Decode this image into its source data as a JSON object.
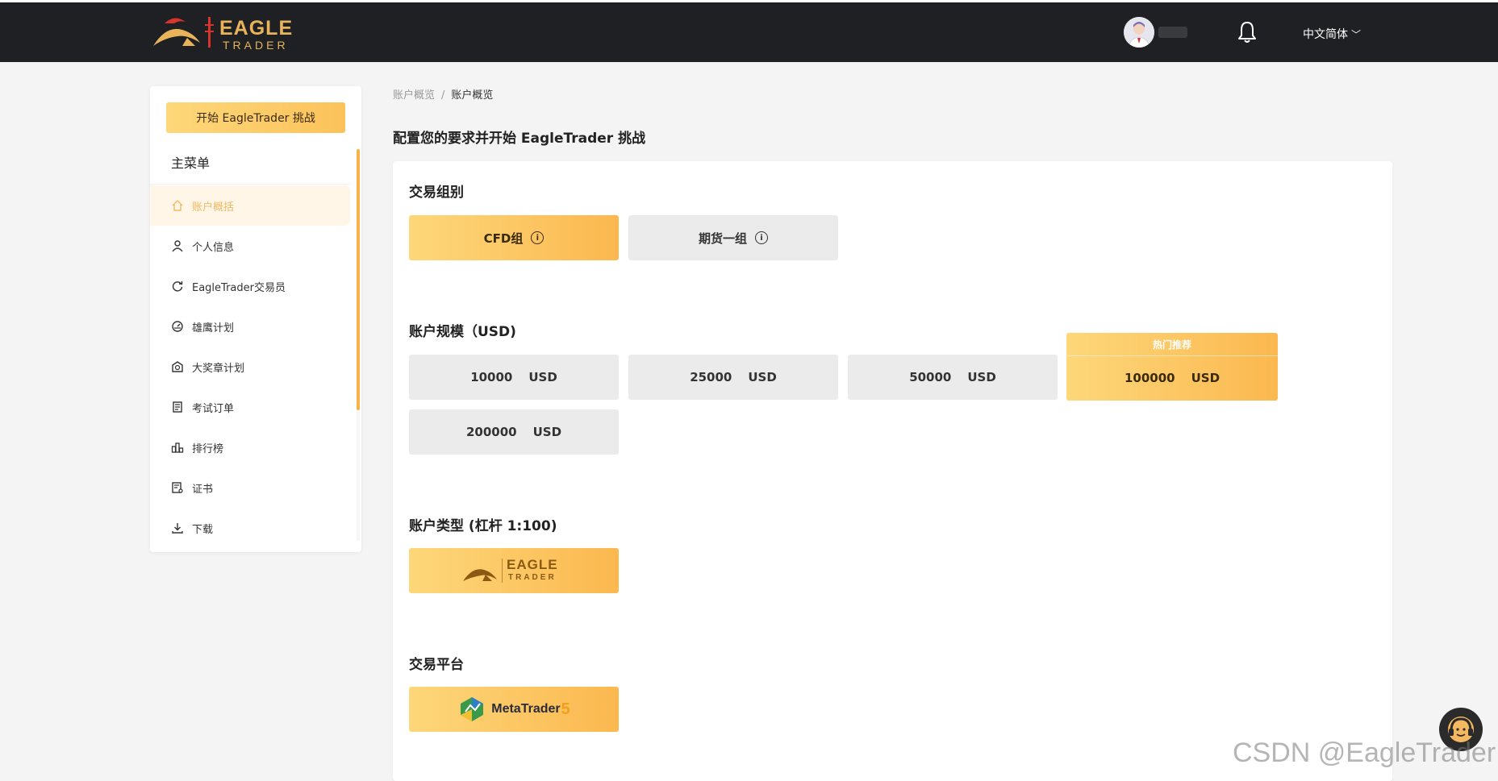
{
  "header": {
    "logo_text_1": "EAGLE",
    "logo_text_2": "TRADER",
    "language": "中文简体"
  },
  "sidebar": {
    "start_button": "开始 EagleTrader 挑战",
    "menu_title": "主菜单",
    "items": [
      {
        "label": "账户概括",
        "icon": "home-icon",
        "active": true
      },
      {
        "label": "个人信息",
        "icon": "user-icon"
      },
      {
        "label": "EagleTrader交易员",
        "icon": "refresh-icon"
      },
      {
        "label": "雄鹰计划",
        "icon": "gauge-icon"
      },
      {
        "label": "大奖章计划",
        "icon": "medal-icon"
      },
      {
        "label": "考试订单",
        "icon": "order-icon"
      },
      {
        "label": "排行榜",
        "icon": "ranking-icon"
      },
      {
        "label": "证书",
        "icon": "certificate-icon"
      },
      {
        "label": "下载",
        "icon": "download-icon"
      }
    ]
  },
  "breadcrumb": {
    "parent": "账户概览",
    "separator": "/",
    "current": "账户概览"
  },
  "main": {
    "page_title": "配置您的要求并开始 EagleTrader 挑战",
    "trading_group": {
      "title": "交易组别",
      "options": [
        {
          "label": "CFD组",
          "selected": true
        },
        {
          "label": "期货一组",
          "selected": false
        }
      ]
    },
    "account_size": {
      "title": "账户规模（USD)",
      "unit": "USD",
      "options": [
        {
          "value": "10000"
        },
        {
          "value": "25000"
        },
        {
          "value": "50000"
        },
        {
          "value": "100000",
          "selected": true,
          "tag": "热门推荐"
        },
        {
          "value": "200000"
        }
      ]
    },
    "account_type": {
      "title": "账户类型 (杠杆 1:100)",
      "logo_text_1": "EAGLE",
      "logo_text_2": "TRADER"
    },
    "platform": {
      "title": "交易平台",
      "name": "MetaTrader",
      "version": "5"
    }
  },
  "watermark": "CSDN @EagleTrader",
  "colors": {
    "topbar": "#1f2023",
    "accent_from": "#fdd77a",
    "accent_to": "#fbb84f",
    "active_text": "#f4b860"
  }
}
